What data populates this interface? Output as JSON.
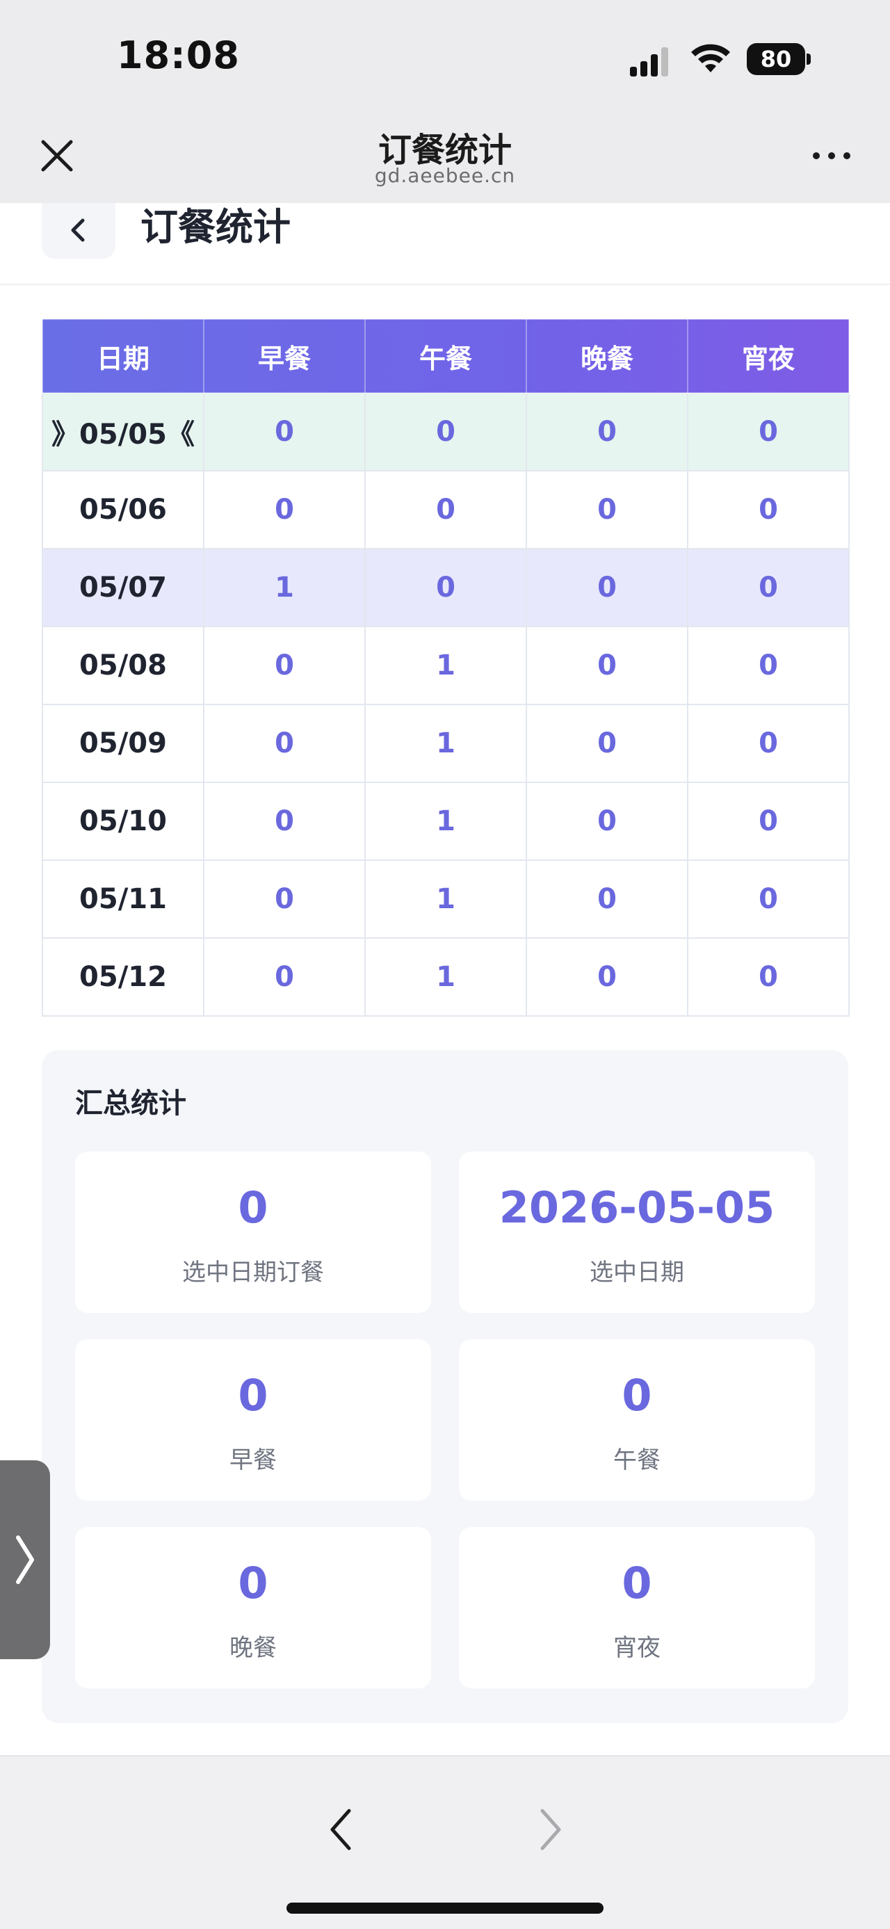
{
  "status_bar": {
    "time": "18:08",
    "battery": "80"
  },
  "browser": {
    "title": "订餐统计",
    "url": "gd.aeebee.cn"
  },
  "page": {
    "heading": "订餐统计"
  },
  "table": {
    "headers": [
      "日期",
      "早餐",
      "午餐",
      "晚餐",
      "宵夜"
    ],
    "rows": [
      {
        "date": "》05/05《",
        "breakfast": "0",
        "lunch": "0",
        "dinner": "0",
        "night": "0"
      },
      {
        "date": "05/06",
        "breakfast": "0",
        "lunch": "0",
        "dinner": "0",
        "night": "0"
      },
      {
        "date": "05/07",
        "breakfast": "1",
        "lunch": "0",
        "dinner": "0",
        "night": "0"
      },
      {
        "date": "05/08",
        "breakfast": "0",
        "lunch": "1",
        "dinner": "0",
        "night": "0"
      },
      {
        "date": "05/09",
        "breakfast": "0",
        "lunch": "1",
        "dinner": "0",
        "night": "0"
      },
      {
        "date": "05/10",
        "breakfast": "0",
        "lunch": "1",
        "dinner": "0",
        "night": "0"
      },
      {
        "date": "05/11",
        "breakfast": "0",
        "lunch": "1",
        "dinner": "0",
        "night": "0"
      },
      {
        "date": "05/12",
        "breakfast": "0",
        "lunch": "1",
        "dinner": "0",
        "night": "0"
      }
    ]
  },
  "summary": {
    "title": "汇总统计",
    "stats": [
      {
        "value": "0",
        "label": "选中日期订餐"
      },
      {
        "value": "2026-05-05",
        "label": "选中日期"
      },
      {
        "value": "0",
        "label": "早餐"
      },
      {
        "value": "0",
        "label": "午餐"
      },
      {
        "value": "0",
        "label": "晚餐"
      },
      {
        "value": "0",
        "label": "宵夜"
      }
    ]
  },
  "colors": {
    "accent": "#6a68de",
    "header_gradient_start": "#6a6ee6",
    "header_gradient_end": "#7f5ce6",
    "current_row": "#e6f5ef",
    "highlight_row": "#e7e8fb"
  }
}
